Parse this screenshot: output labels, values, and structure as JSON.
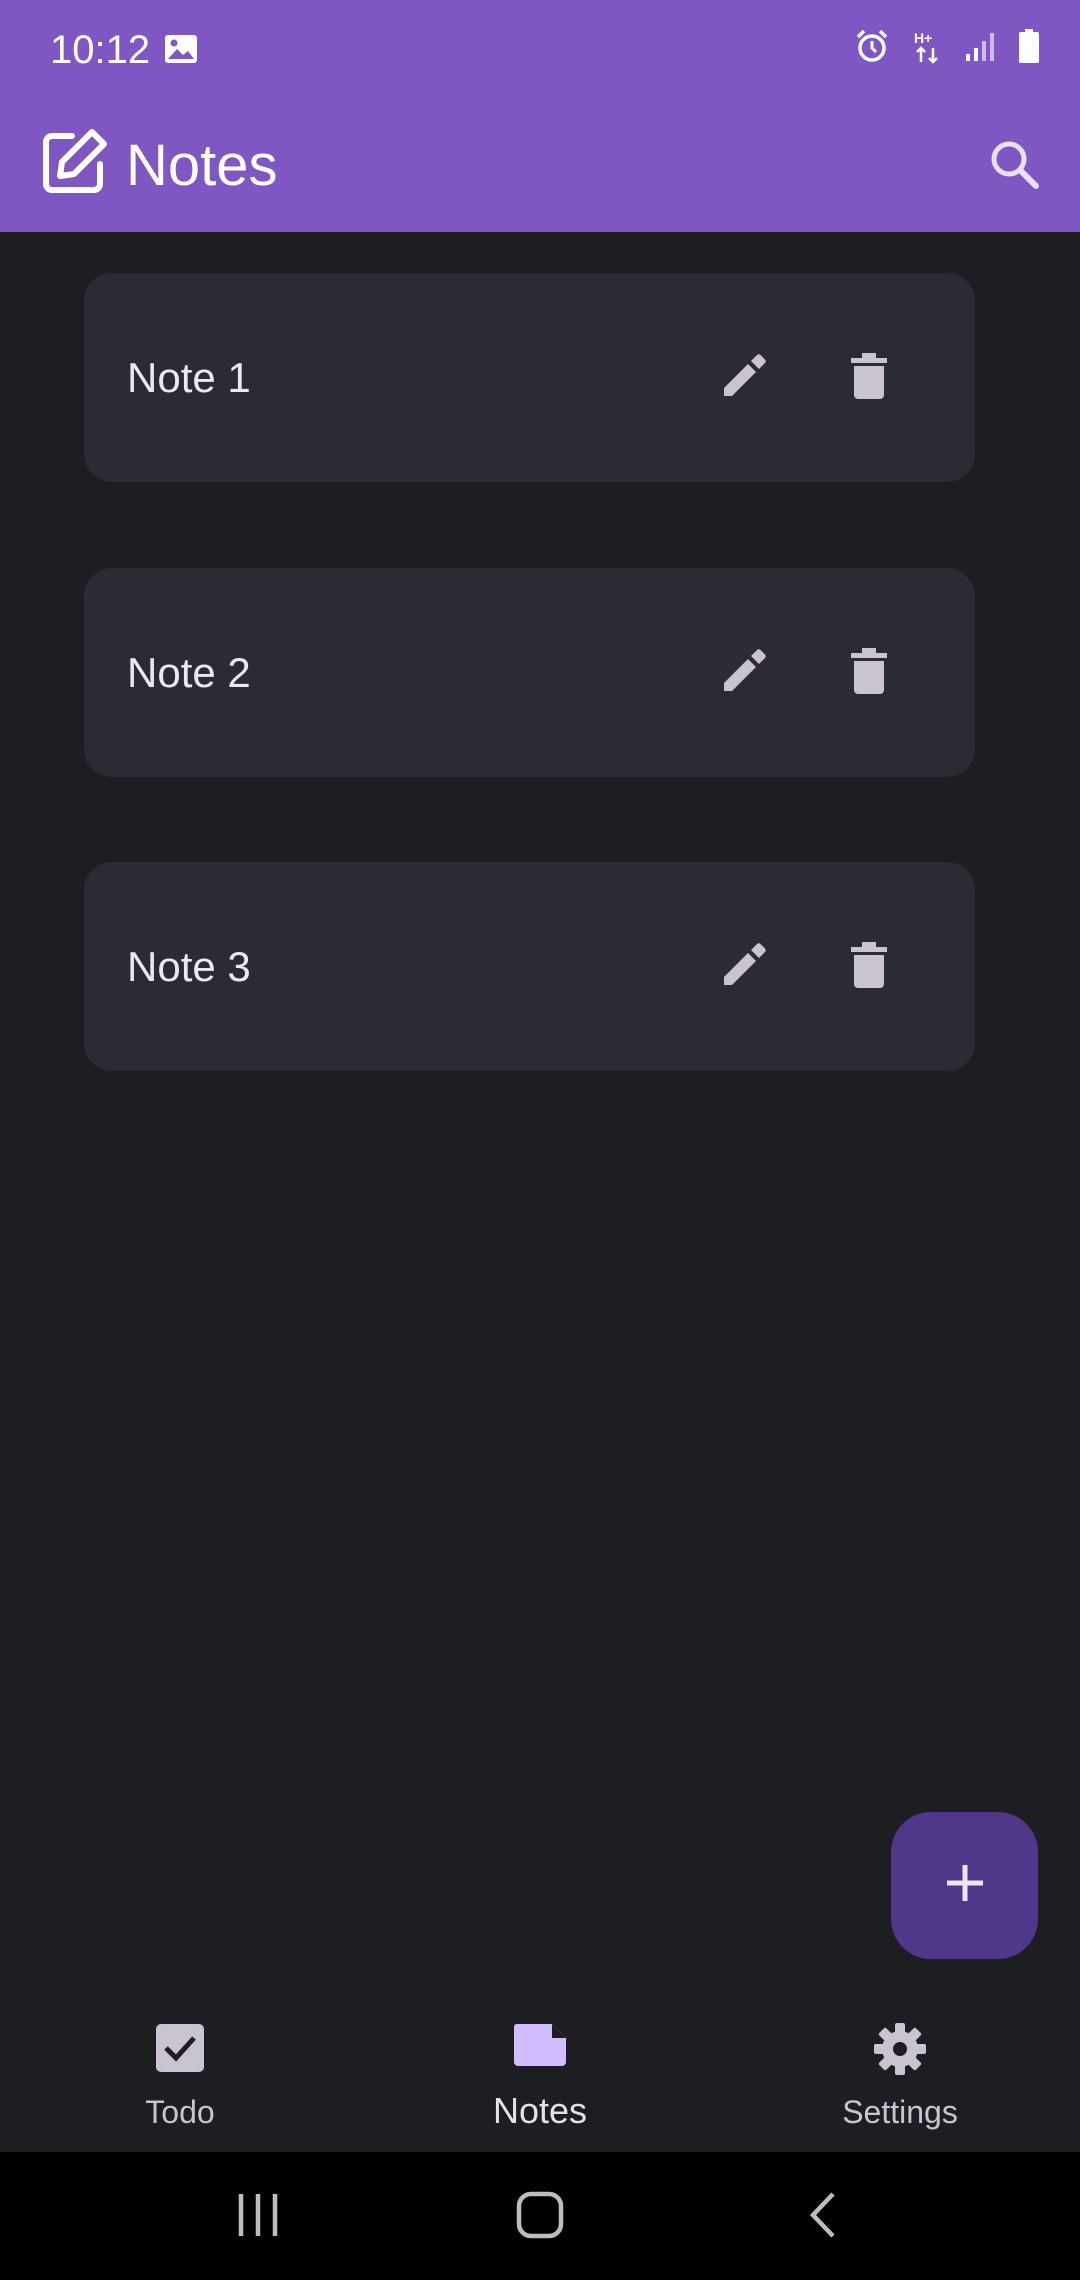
{
  "status_bar": {
    "time": "10:12",
    "icons": [
      "image-icon",
      "alarm-icon",
      "data-transfer-icon",
      "signal-icon",
      "battery-icon"
    ]
  },
  "app_bar": {
    "title": "Notes",
    "logo_icon": "edit-square-icon",
    "search_icon": "search-icon"
  },
  "notes": [
    {
      "title": "Note 1"
    },
    {
      "title": "Note 2"
    },
    {
      "title": "Note 3"
    }
  ],
  "fab": {
    "icon": "plus-icon"
  },
  "bottom_nav": {
    "items": [
      {
        "label": "Todo",
        "icon": "checkbox-icon",
        "active": false
      },
      {
        "label": "Notes",
        "icon": "note-icon",
        "active": true
      },
      {
        "label": "Settings",
        "icon": "gear-icon",
        "active": false
      }
    ]
  },
  "colors": {
    "primary": "#7f57c2",
    "background": "#1e1d22",
    "card": "#2c2a32",
    "fab": "#4f378a",
    "icon": "#cac4d0",
    "active_icon": "#d0bcff"
  }
}
